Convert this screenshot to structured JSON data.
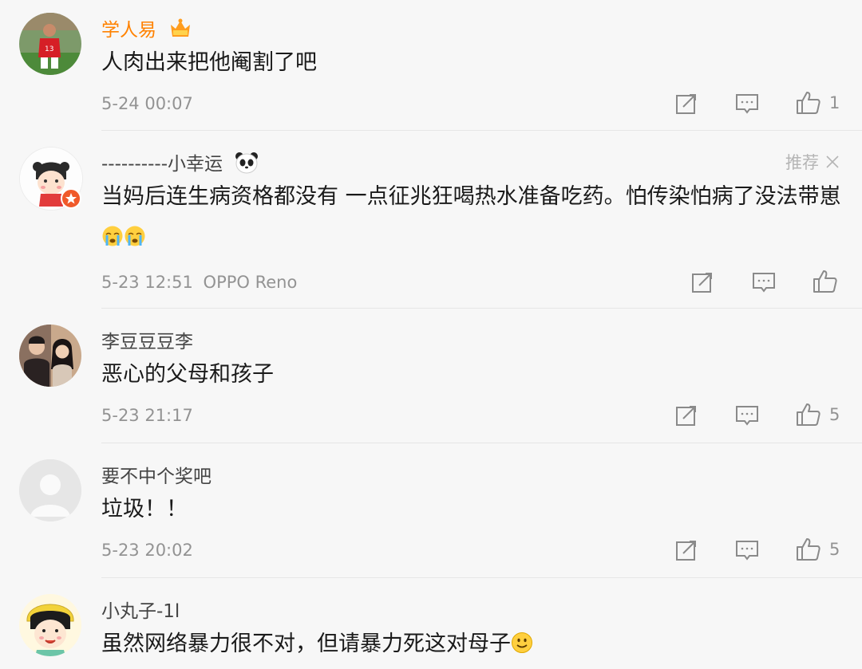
{
  "comments": [
    {
      "username": "学人易",
      "text": "人肉出来把他阉割了吧",
      "time": "5-24 00:07",
      "likes": "1"
    },
    {
      "username": "----------小幸运",
      "text": "当妈后连生病资格都没有 一点征兆狂喝热水准备吃药。怕传染怕病了没法带崽",
      "time": "5-23 12:51",
      "device": "OPPO Reno",
      "likes": "",
      "recommend_label": "推荐"
    },
    {
      "username": "李豆豆豆李",
      "text": "恶心的父母和孩子",
      "time": "5-23 21:17",
      "likes": "5"
    },
    {
      "username": "要不中个奖吧",
      "text": "垃圾！！",
      "time": "5-23 20:02",
      "likes": "5"
    },
    {
      "username": "小丸子-1l",
      "text": "虽然网络暴力很不对，但请暴力死这对母子",
      "time": "",
      "likes": ""
    }
  ],
  "icons": {
    "repost": "repost-icon",
    "comment": "comment-icon",
    "like": "thumbs-up-icon",
    "dismiss": "close-icon",
    "vip_badge": "vip-crown-icon",
    "panda": "panda-emoji",
    "crying": "crying-emoji",
    "smile": "smile-emoji"
  },
  "colors": {
    "vip_name": "#ff8200",
    "name": "#444444",
    "text": "#1a1a1a",
    "meta": "#939393",
    "background": "#f7f7f7"
  }
}
